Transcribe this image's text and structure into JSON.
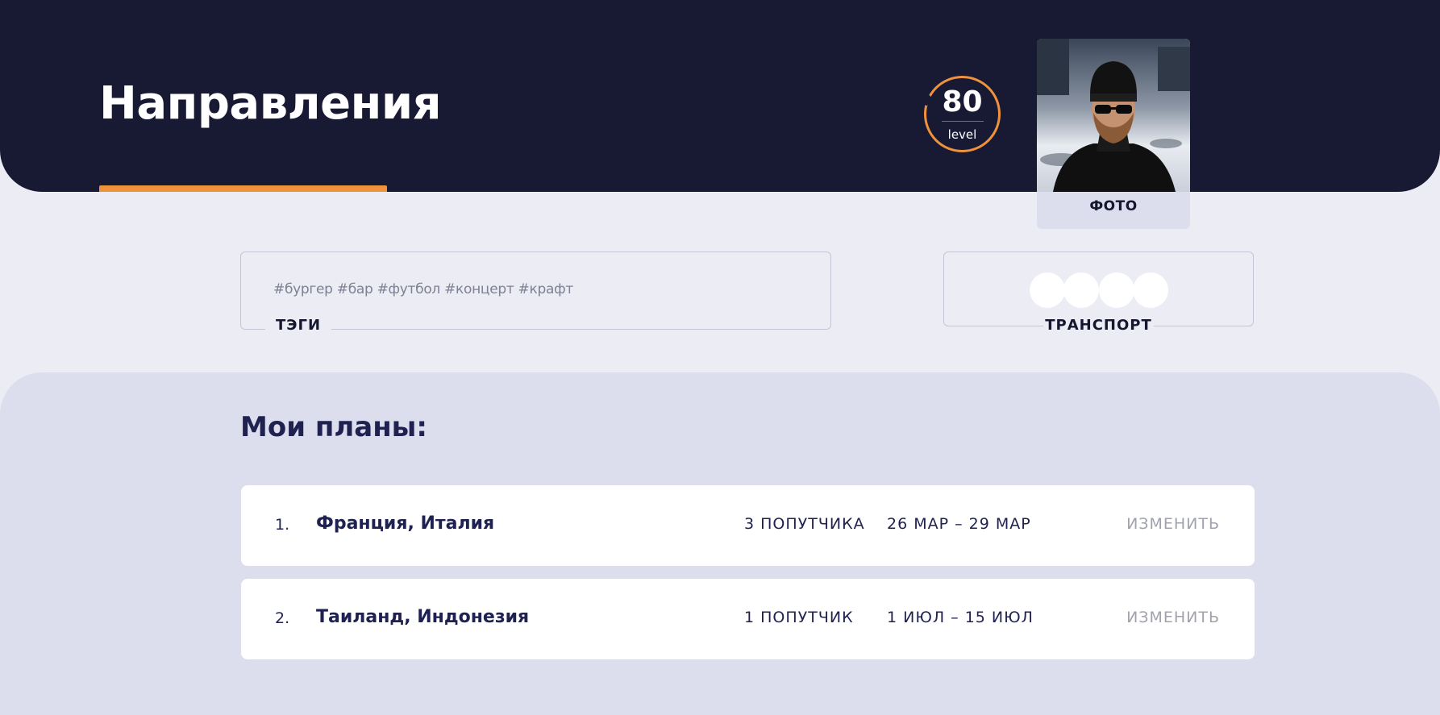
{
  "header": {
    "title": "Направления",
    "accent_color": "#f0913c",
    "background_color": "#181a33"
  },
  "level": {
    "value": "80",
    "label": "level"
  },
  "photo": {
    "label": "ФОТО"
  },
  "tags": {
    "text": "#бургер #бар #футбол #концерт #крафт",
    "label": "ТЭГИ"
  },
  "transport": {
    "label": "ТРАНСПОРТ",
    "slots": 4
  },
  "plans": {
    "title": "Мои планы:",
    "items": [
      {
        "num": "1.",
        "destination": "Франция, Италия",
        "companions": "3 ПОПУТЧИКА",
        "dates": "26 МАР – 29 МАР",
        "edit": "ИЗМЕНИТЬ"
      },
      {
        "num": "2.",
        "destination": "Таиланд, Индонезия",
        "companions": "1 ПОПУТЧИК",
        "dates": "1 ИЮЛ – 15 ИЮЛ",
        "edit": "ИЗМЕНИТЬ"
      }
    ]
  }
}
